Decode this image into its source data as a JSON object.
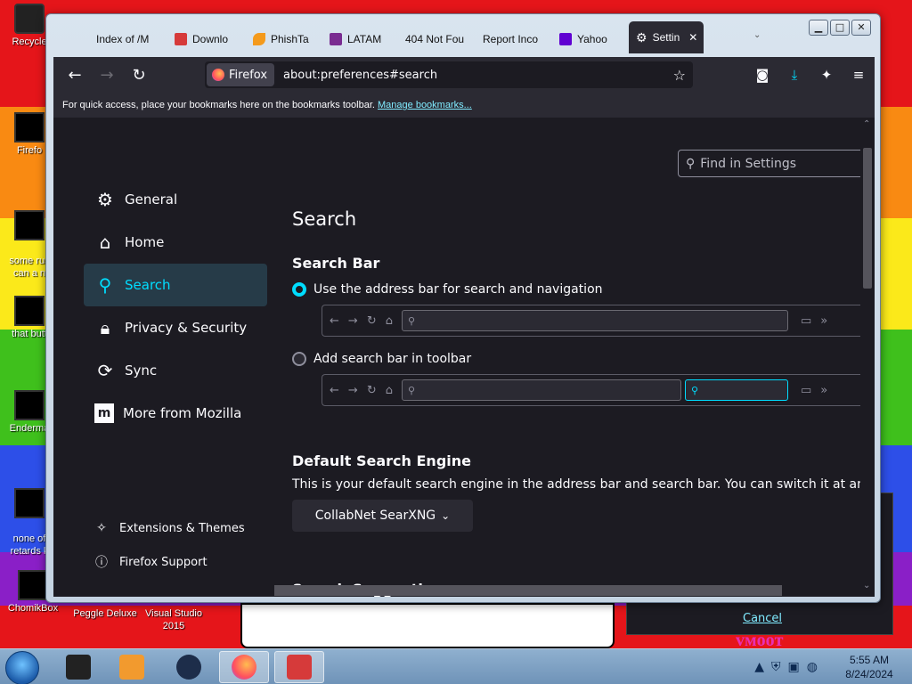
{
  "desktop": {
    "icons": [
      {
        "label": "Recycle"
      },
      {
        "label": "Firefo"
      },
      {
        "label": "some rus\ncan a n"
      },
      {
        "label": "that butt"
      },
      {
        "label": "Enderma"
      },
      {
        "label": "none of\nretards k"
      },
      {
        "label": "ChomikBox"
      },
      {
        "label": "Peggle Deluxe"
      },
      {
        "label": "Visual Studio 2015"
      }
    ],
    "background_text": "vмooт"
  },
  "tabs": [
    {
      "label": "Index of /M",
      "color": "#cfd8e3"
    },
    {
      "label": "Downlo",
      "color": "#d63a3a"
    },
    {
      "label": "PhishTa",
      "color": "#f49a1c"
    },
    {
      "label": "LATAM",
      "color": "#7a2c91"
    },
    {
      "label": "404 Not Fou",
      "color": "#cfd8e3"
    },
    {
      "label": "Report Inco",
      "color": "#cfd8e3"
    },
    {
      "label": "Yahoo",
      "color": "#6001d2"
    },
    {
      "label": "Settin",
      "active": true
    }
  ],
  "window_controls": {
    "minimize": "▁",
    "maximize": "□",
    "close": "✕"
  },
  "toolbar": {
    "identity_label": "Firefox",
    "url": "about:preferences#search"
  },
  "bookmarks_bar": {
    "text": "For quick access, place your bookmarks here on the bookmarks toolbar.",
    "link": "Manage bookmarks..."
  },
  "settings": {
    "find_placeholder": "Find in Settings",
    "categories": [
      {
        "label": "General",
        "icon": "gear-icon"
      },
      {
        "label": "Home",
        "icon": "home-icon"
      },
      {
        "label": "Search",
        "icon": "search-icon",
        "selected": true
      },
      {
        "label": "Privacy & Security",
        "icon": "lock-icon"
      },
      {
        "label": "Sync",
        "icon": "sync-icon"
      },
      {
        "label": "More from Mozilla",
        "icon": "mozilla-icon"
      }
    ],
    "footer_links": [
      {
        "label": "Extensions & Themes",
        "icon": "puzzle-icon"
      },
      {
        "label": "Firefox Support",
        "icon": "help-icon"
      }
    ],
    "page_title": "Search",
    "search_bar": {
      "heading": "Search Bar",
      "option_address": "Use the address bar for search and navigation",
      "option_toolbar": "Add search bar in toolbar",
      "selected": "address"
    },
    "default_engine": {
      "heading": "Default Search Engine",
      "description": "This is your default search engine in the address bar and search bar. You can switch it at any time",
      "engine": "CollabNet SearXNG"
    },
    "suggestions_heading": "Search Suggestions"
  },
  "dialog": {
    "cancel_label": "Cancel"
  },
  "taskbar": {
    "time": "5:55 AM",
    "date": "8/24/2024"
  },
  "colors": {
    "accent": "#00ddff",
    "content_bg": "#1c1b22",
    "chrome_bg": "#2b2a33"
  }
}
